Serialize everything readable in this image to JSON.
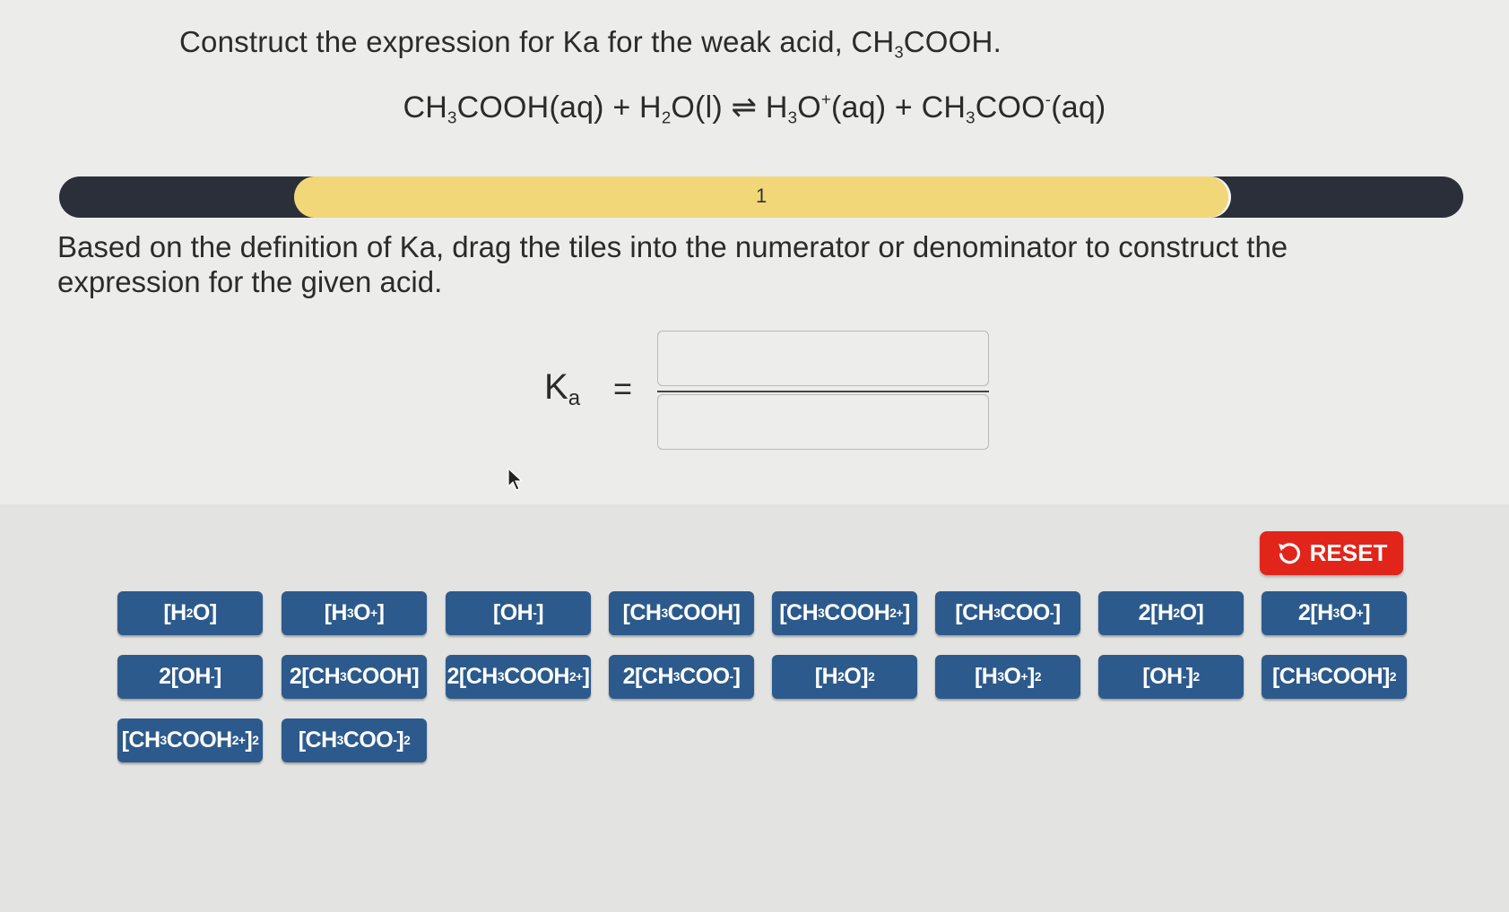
{
  "question": {
    "title_text": "Construct the expression for Ka for the weak acid, CH",
    "title_sub": "3",
    "title_tail": "COOH."
  },
  "equation": {
    "p1": "CH",
    "s1": "3",
    "p2": "COOH(aq) + H",
    "s2": "2",
    "p3": "O(l) ",
    "arrow": "⇌",
    "p4": " H",
    "s3": "3",
    "p5": "O",
    "sup1": "+",
    "p6": "(aq) + CH",
    "s4": "3",
    "p7": "COO",
    "sup2": "-",
    "p8": "(aq)"
  },
  "progress": {
    "step": "1",
    "value_fraction": 0.67
  },
  "instruction": "Based on the definition of Ka, drag the tiles into the numerator or denominator to construct the expression for the given acid.",
  "expression": {
    "ka_main": "K",
    "ka_sub": "a",
    "equals": "="
  },
  "reset_label": "RESET",
  "colors": {
    "tile": "#2c5a8c",
    "reset": "#e1251b",
    "progress_fill": "#f2d778",
    "progress_track": "#2a2f3a"
  },
  "tiles": [
    {
      "a": "[H",
      "s": "2",
      "b": "O]",
      "p": "",
      "c": "",
      "d": ""
    },
    {
      "a": "[H",
      "s": "3",
      "b": "O",
      "p": "+",
      "c": "]",
      "d": ""
    },
    {
      "a": "[OH",
      "s": "",
      "b": "",
      "p": "-",
      "c": "]",
      "d": ""
    },
    {
      "a": "[CH",
      "s": "3",
      "b": "COOH]",
      "p": "",
      "c": "",
      "d": ""
    },
    {
      "a": "[CH",
      "s": "3",
      "b": "COOH",
      "p": "",
      "c": "",
      "d": "2+]"
    },
    {
      "a": "[CH",
      "s": "3",
      "b": "COO",
      "p": "-",
      "c": "]",
      "d": ""
    },
    {
      "a": "2[H",
      "s": "2",
      "b": "O]",
      "p": "",
      "c": "",
      "d": ""
    },
    {
      "a": "2[H",
      "s": "3",
      "b": "O",
      "p": "+",
      "c": "]",
      "d": ""
    },
    {
      "a": "2[OH",
      "s": "",
      "b": "",
      "p": "-",
      "c": "]",
      "d": ""
    },
    {
      "a": "2[CH",
      "s": "3",
      "b": "COOH]",
      "p": "",
      "c": "",
      "d": ""
    },
    {
      "a": "2[CH",
      "s": "3",
      "b": "COOH",
      "p": "",
      "c": "",
      "d": "2+]"
    },
    {
      "a": "2[CH",
      "s": "3",
      "b": "COO",
      "p": "-",
      "c": "]",
      "d": ""
    },
    {
      "a": "[H",
      "s": "2",
      "b": "O]",
      "p": "2",
      "c": "",
      "d": ""
    },
    {
      "a": "[H",
      "s": "3",
      "b": "O",
      "p": "+",
      "c": "]",
      "d": "2"
    },
    {
      "a": "[OH",
      "s": "",
      "b": "",
      "p": "-",
      "c": "]",
      "d": "2"
    },
    {
      "a": "[CH",
      "s": "3",
      "b": "COOH]",
      "p": "2",
      "c": "",
      "d": ""
    },
    {
      "a": "[CH",
      "s": "3",
      "b": "COOH",
      "p": "",
      "c": "",
      "d": "2+]2"
    },
    {
      "a": "[CH",
      "s": "3",
      "b": "COO",
      "p": "-",
      "c": "]",
      "d": "2"
    }
  ]
}
